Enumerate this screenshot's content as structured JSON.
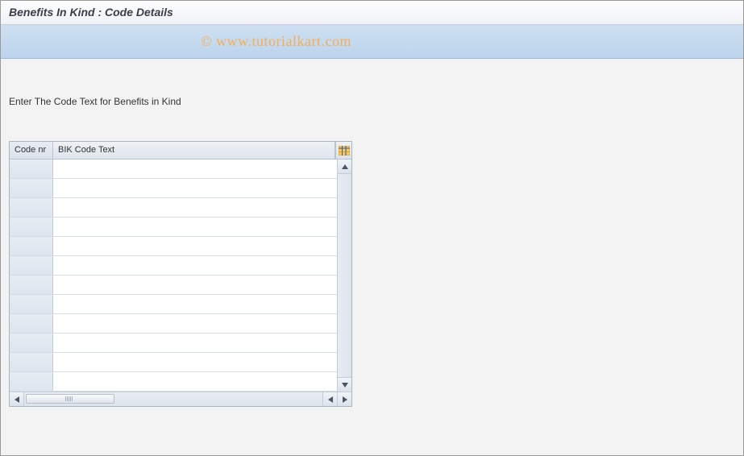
{
  "header": {
    "title": "Benefits In Kind : Code Details"
  },
  "watermark": "© www.tutorialkart.com",
  "main": {
    "instruction": "Enter The Code Text for Benefits in Kind",
    "table": {
      "columns": {
        "code": "Code nr",
        "text": "BIK Code Text"
      },
      "row_count": 12
    }
  }
}
